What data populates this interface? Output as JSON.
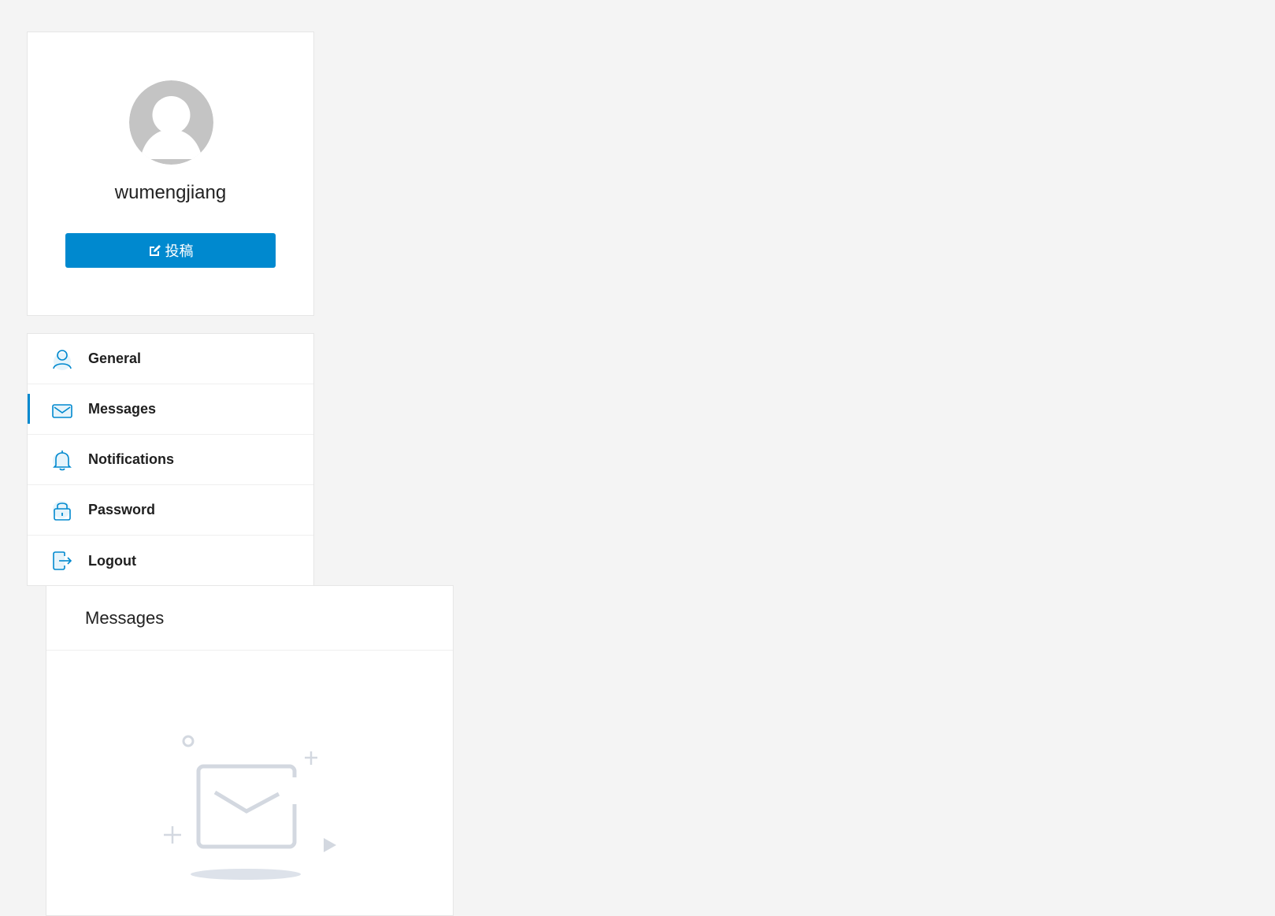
{
  "profile": {
    "username": "wumengjiang",
    "post_button_label": "投稿"
  },
  "menu": {
    "items": [
      {
        "label": "General",
        "icon": "user-icon"
      },
      {
        "label": "Messages",
        "icon": "mail-icon",
        "active": true
      },
      {
        "label": "Notifications",
        "icon": "bell-icon"
      },
      {
        "label": "Password",
        "icon": "lock-icon"
      },
      {
        "label": "Logout",
        "icon": "logout-icon"
      }
    ]
  },
  "messages_panel": {
    "title": "Messages"
  },
  "colors": {
    "accent": "#0089cf",
    "background": "#f4f4f4",
    "avatar_gray": "#c4c4c4"
  }
}
